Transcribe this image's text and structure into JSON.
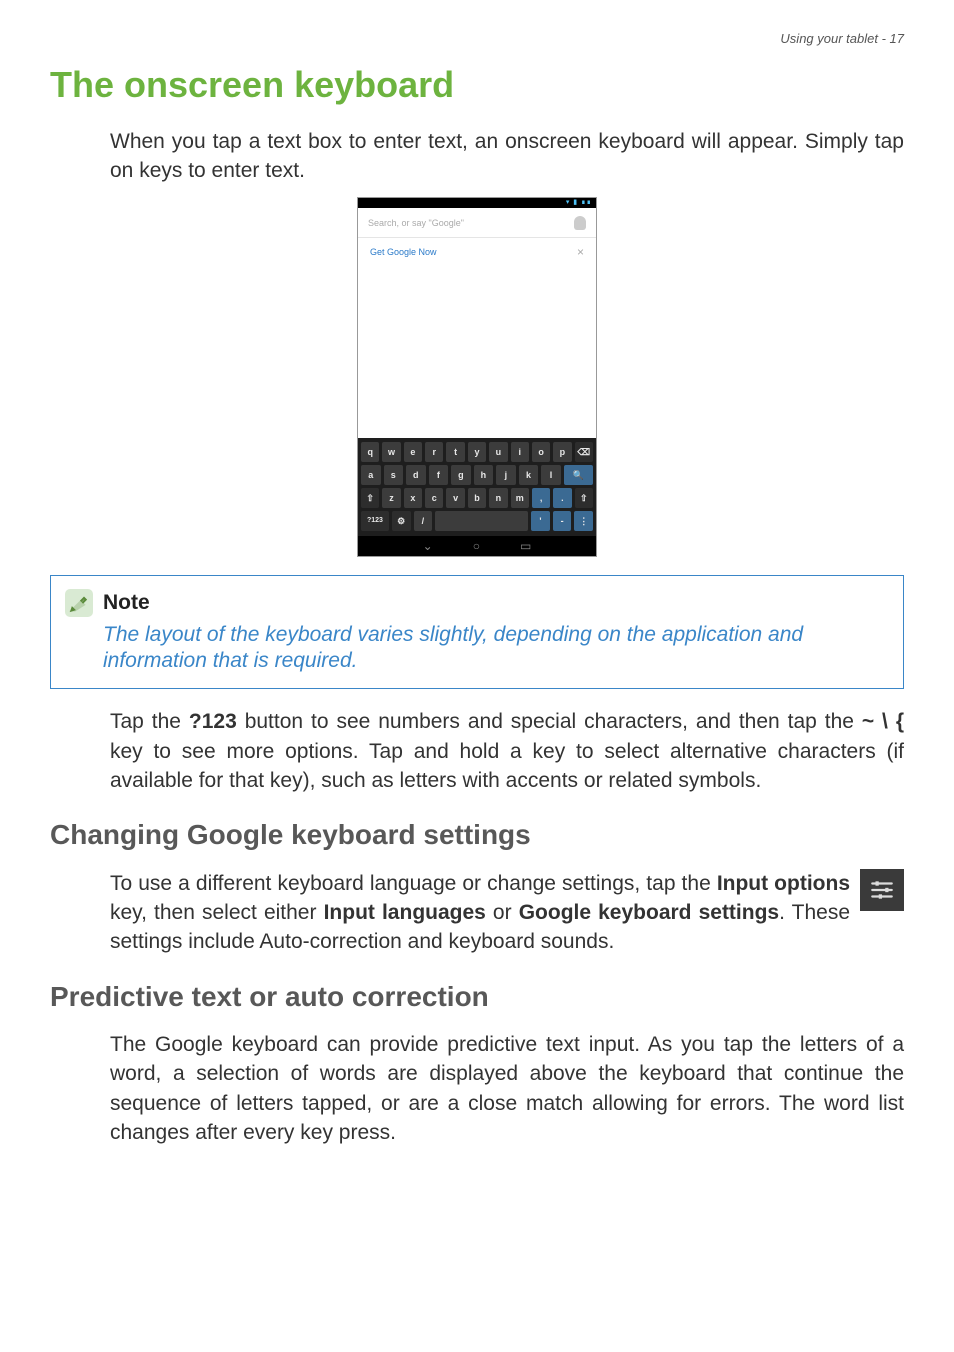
{
  "header": {
    "breadcrumb": "Using your tablet - 17"
  },
  "section_title": "The onscreen keyboard",
  "intro_paragraph": "When you tap a text box to enter text, an onscreen keyboard will appear. Simply tap on keys to enter text.",
  "screenshot": {
    "search_placeholder": "Search, or say \"Google\"",
    "get_now": "Get Google Now",
    "close": "×",
    "keyboard": {
      "row1": [
        "q",
        "w",
        "e",
        "r",
        "t",
        "y",
        "u",
        "i",
        "o",
        "p",
        "⌫"
      ],
      "row2": [
        "a",
        "s",
        "d",
        "f",
        "g",
        "h",
        "j",
        "k",
        "l",
        "🔍"
      ],
      "row3": [
        "⇧",
        "z",
        "x",
        "c",
        "v",
        "b",
        "n",
        "m",
        ",",
        ".",
        "⇧"
      ],
      "row4_left": "?123",
      "row4_opts": "⚙",
      "row4_slash": "/",
      "row4_apos": "'",
      "row4_dash": "-",
      "row4_menu": "⋮"
    },
    "nav": {
      "back": "⌄",
      "home": "○",
      "recent": "▭"
    }
  },
  "note": {
    "title": "Note",
    "body": "The layout of the keyboard varies slightly, depending on the application and information that is required."
  },
  "para2_a": "Tap the ",
  "para2_btn": "?123",
  "para2_b": " button to see numbers and special characters, and then tap the ",
  "para2_key": "~ \\ {",
  "para2_c": " key to see more options. Tap and hold a key to select alternative characters (if available for that key), such as letters with accents or related symbols.",
  "h2_changing": "Changing Google keyboard settings",
  "para3_a": "To use a different keyboard language or change settings, tap the ",
  "para3_b1": "Input options",
  "para3_c": " key, then select either ",
  "para3_b2": "Input languages",
  "para3_d": " or ",
  "para3_b3": "Google keyboard settings",
  "para3_e": ". These settings include Auto-correction and keyboard sounds.",
  "h2_predictive": "Predictive text or auto correction",
  "para4": "The Google keyboard can provide predictive text input. As you tap the letters of a word, a selection of words are displayed above the keyboard that continue the sequence of letters tapped, or are a close match allowing for errors. The word list changes after every key press."
}
